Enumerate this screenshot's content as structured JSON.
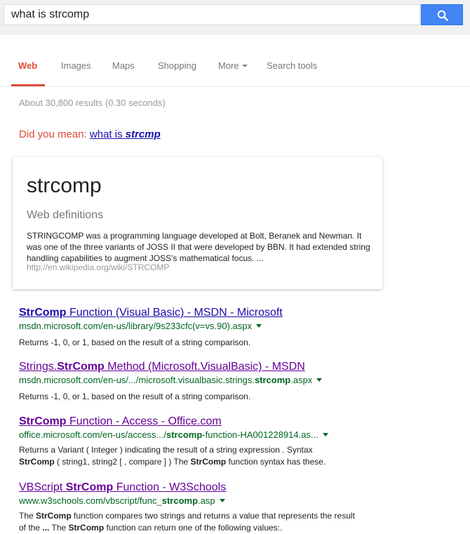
{
  "search": {
    "query": "what is strcomp"
  },
  "tabs": [
    {
      "label": "Web"
    },
    {
      "label": "Images"
    },
    {
      "label": "Maps"
    },
    {
      "label": "Shopping"
    },
    {
      "label": "More"
    },
    {
      "label": "Search tools"
    }
  ],
  "stats": "About 30,800 results (0.30 seconds)",
  "did_you_mean": {
    "prefix": "Did you mean:",
    "plain": "what is ",
    "bold": "strcmp"
  },
  "definition": {
    "word": "strcomp",
    "source": "Web definitions",
    "text": "STRINGCOMP was a programming language developed at Bolt, Beranek and Newman. It was one of the three variants of JOSS II that were developed by BBN. It had extended string handling capabilities to augment JOSS's mathematical focus. ...",
    "url": "http://en.wikipedia.org/wiki/STRCOMP"
  },
  "results": [
    {
      "title_bold": "StrComp",
      "title_rest": " Function (Visual Basic) - MSDN - Microsoft",
      "url": "msdn.microsoft.com/en-us/library/9s233cfc(v=vs.90).aspx",
      "snippet": "Returns -1, 0, or 1, based on the result of a string comparison."
    },
    {
      "title_pre": "Strings.",
      "title_bold": "StrComp",
      "title_rest": " Method (Microsoft.VisualBasic) - MSDN",
      "url_pre": "msdn.microsoft.com/en-us/.../microsoft.visualbasic.strings.",
      "url_bold": "strcomp",
      "url_post": ".aspx",
      "snippet": "Returns -1, 0, or 1, based on the result of a string comparison."
    },
    {
      "title_bold": "StrComp",
      "title_rest": " Function - Access - Office.com",
      "url_pre": "office.microsoft.com/en-us/access.../",
      "url_bold": "strcomp",
      "url_post": "-function-HA001228914.as...",
      "snippet_line1": "Returns a Variant ( Integer ) indicating the result of a string expression . Syntax",
      "snippet_bold1": "StrComp",
      "snippet_mid": " ( string1, string2 [ , compare ] ) The ",
      "snippet_bold2": "StrComp",
      "snippet_end": " function syntax has these."
    },
    {
      "title_pre": "VBScript ",
      "title_bold": "StrComp",
      "title_rest": " Function - W3Schools",
      "url_pre": "www.w3schools.com/vbscript/func_",
      "url_bold": "strcomp",
      "url_post": ".asp",
      "snippet_a": "The ",
      "snippet_bold1": "StrComp",
      "snippet_b": " function compares two strings and returns a value that represents the result of the ",
      "snippet_bold2": "...",
      "snippet_c": " The ",
      "snippet_bold3": "StrComp",
      "snippet_d": " function can return one of the following values:."
    }
  ]
}
